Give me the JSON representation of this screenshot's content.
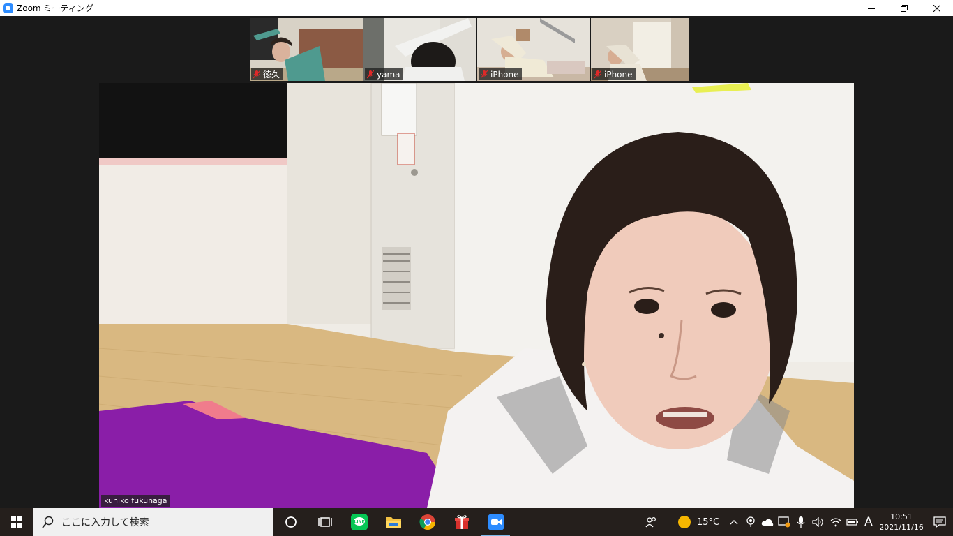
{
  "window": {
    "title": "Zoom ミーティング"
  },
  "thumbnails": [
    {
      "name": "徳久",
      "muted": true
    },
    {
      "name": "yama",
      "muted": true
    },
    {
      "name": "iPhone",
      "muted": true
    },
    {
      "name": "iPhone",
      "muted": true
    }
  ],
  "main_video": {
    "speaker_name": "kuniko fukunaga"
  },
  "taskbar": {
    "search_placeholder": "ここに入力して検索",
    "pinned_apps": [
      "task-view",
      "line",
      "file-explorer",
      "chrome",
      "gift",
      "zoom"
    ],
    "weather": "15°C",
    "ime_mode": "A",
    "time": "10:51",
    "date": "2021/11/16"
  },
  "colors": {
    "zoom_blue": "#2d8cff",
    "taskbar_bg": "#251f1c",
    "mat_purple": "#8a1ea8",
    "muted_red": "#e02828"
  }
}
